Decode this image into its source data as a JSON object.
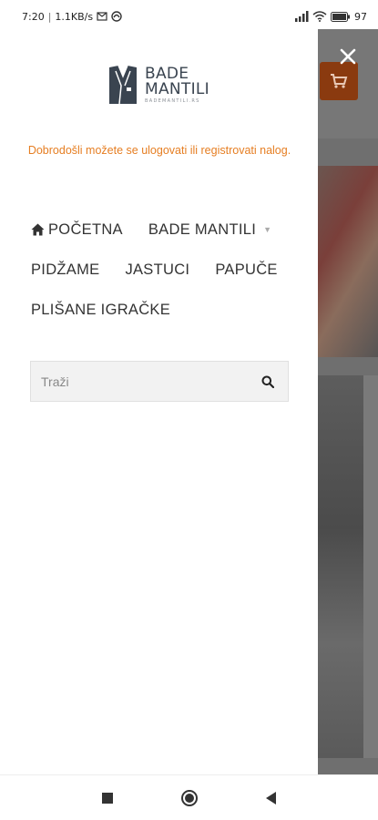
{
  "status_bar": {
    "time": "7:20",
    "speed": "1.1KB/s",
    "battery": "97"
  },
  "drawer": {
    "logo": {
      "line1": "BADE",
      "line2": "MANTILI",
      "subtitle": "BADEMANTILI.RS"
    },
    "welcome_text": "Dobrodošli možete se ulogovati ili registrovati nalog.",
    "menu": {
      "home": "POČETNA",
      "bade_mantili": "BADE MANTILI",
      "pidzame": "PIDŽAME",
      "jastuci": "JASTUCI",
      "papuce": "PAPUČE",
      "plisane": "PLIŠANE IGRAČKE"
    },
    "search": {
      "placeholder": "Traži"
    }
  },
  "colors": {
    "accent": "#e67e22",
    "cart_button": "#8a3a0f",
    "overlay": "#6f6f6f"
  },
  "icons": {
    "home": "home-icon",
    "dropdown": "chevron-down-icon",
    "search": "search-icon",
    "close": "close-icon",
    "cart": "cart-icon",
    "nav_recent": "square-icon",
    "nav_home": "circle-icon",
    "nav_back": "back-triangle-icon"
  }
}
